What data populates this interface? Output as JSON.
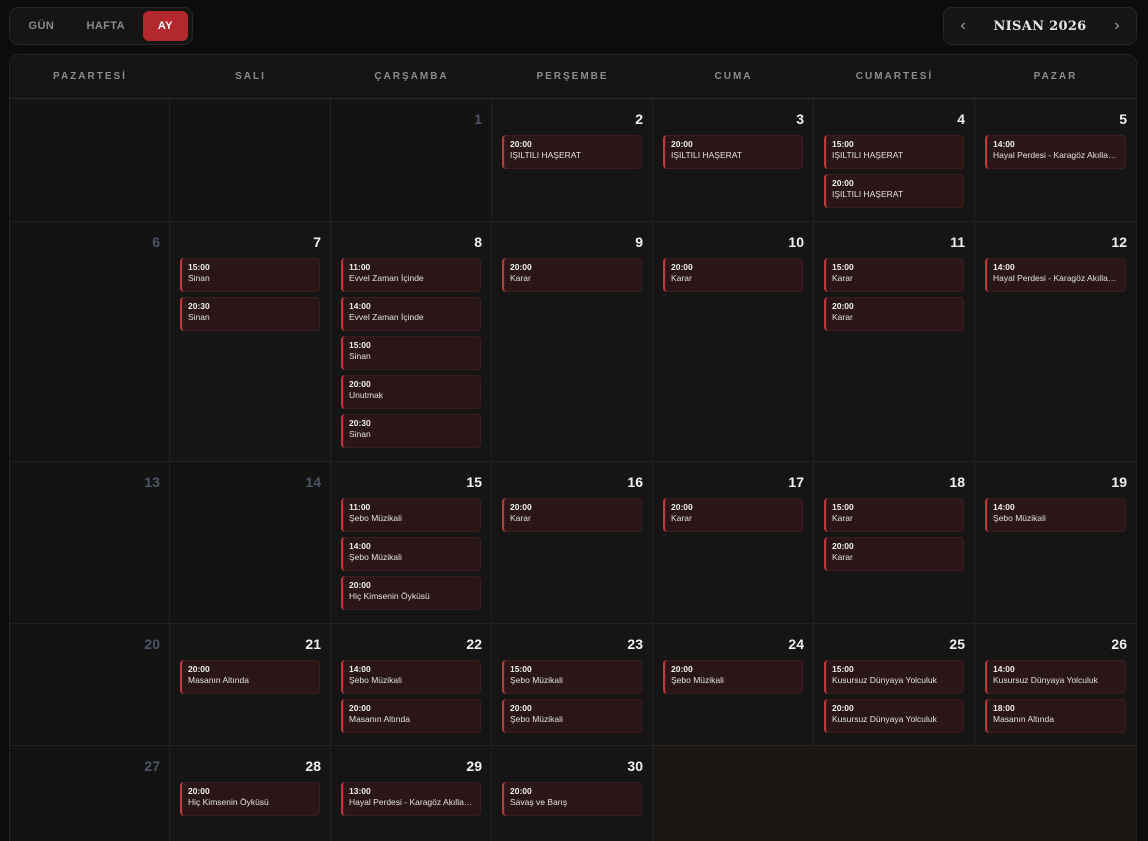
{
  "view_switch": {
    "gun": "GÜN",
    "hafta": "HAFTA",
    "ay": "AY",
    "active": "AY"
  },
  "month_nav": {
    "prev": "‹",
    "title": "NISAN 2026",
    "next": "›"
  },
  "colors": {
    "accent": "#b3282c",
    "event_bg": "#2a1616",
    "event_border": "#c0393c"
  },
  "weekdays": [
    "PAZARTESİ",
    "SALI",
    "ÇARŞAMBA",
    "PERŞEMBE",
    "CUMA",
    "CUMARTESİ",
    "PAZAR"
  ],
  "weeks": [
    [
      {
        "day": "",
        "muted": true,
        "events": []
      },
      {
        "day": "",
        "muted": true,
        "events": []
      },
      {
        "day": "1",
        "muted": true,
        "events": []
      },
      {
        "day": "2",
        "muted": false,
        "events": [
          {
            "time": "20:00",
            "title": "IŞILTILI HAŞERAT"
          }
        ]
      },
      {
        "day": "3",
        "muted": false,
        "events": [
          {
            "time": "20:00",
            "title": "IŞILTILI HAŞERAT"
          }
        ]
      },
      {
        "day": "4",
        "muted": false,
        "events": [
          {
            "time": "15:00",
            "title": "IŞILTILI HAŞERAT"
          },
          {
            "time": "20:00",
            "title": "IŞILTILI HAŞERAT"
          }
        ]
      },
      {
        "day": "5",
        "muted": false,
        "events": [
          {
            "time": "14:00",
            "title": "Hayal Perdesi - Karagöz Akıllanıy..."
          }
        ]
      }
    ],
    [
      {
        "day": "6",
        "muted": true,
        "events": []
      },
      {
        "day": "7",
        "muted": false,
        "events": [
          {
            "time": "15:00",
            "title": "Sinan"
          },
          {
            "time": "20:30",
            "title": "Sinan"
          }
        ]
      },
      {
        "day": "8",
        "muted": false,
        "events": [
          {
            "time": "11:00",
            "title": "Evvel Zaman İçinde"
          },
          {
            "time": "14:00",
            "title": "Evvel Zaman İçinde"
          },
          {
            "time": "15:00",
            "title": "Sinan"
          },
          {
            "time": "20:00",
            "title": "Unutmak"
          },
          {
            "time": "20:30",
            "title": "Sinan"
          }
        ]
      },
      {
        "day": "9",
        "muted": false,
        "events": [
          {
            "time": "20:00",
            "title": "Karar"
          }
        ]
      },
      {
        "day": "10",
        "muted": false,
        "events": [
          {
            "time": "20:00",
            "title": "Karar"
          }
        ]
      },
      {
        "day": "11",
        "muted": false,
        "events": [
          {
            "time": "15:00",
            "title": "Karar"
          },
          {
            "time": "20:00",
            "title": "Karar"
          }
        ]
      },
      {
        "day": "12",
        "muted": false,
        "events": [
          {
            "time": "14:00",
            "title": "Hayal Perdesi - Karagöz Akıllanıy..."
          }
        ]
      }
    ],
    [
      {
        "day": "13",
        "muted": true,
        "events": []
      },
      {
        "day": "14",
        "muted": true,
        "events": []
      },
      {
        "day": "15",
        "muted": false,
        "events": [
          {
            "time": "11:00",
            "title": "Şebo Müzikali"
          },
          {
            "time": "14:00",
            "title": "Şebo Müzikali"
          },
          {
            "time": "20:00",
            "title": "Hiç Kimsenin Öyküsü"
          }
        ]
      },
      {
        "day": "16",
        "muted": false,
        "events": [
          {
            "time": "20:00",
            "title": "Karar"
          }
        ]
      },
      {
        "day": "17",
        "muted": false,
        "events": [
          {
            "time": "20:00",
            "title": "Karar"
          }
        ]
      },
      {
        "day": "18",
        "muted": false,
        "events": [
          {
            "time": "15:00",
            "title": "Karar"
          },
          {
            "time": "20:00",
            "title": "Karar"
          }
        ]
      },
      {
        "day": "19",
        "muted": false,
        "events": [
          {
            "time": "14:00",
            "title": "Şebo Müzikali"
          }
        ]
      }
    ],
    [
      {
        "day": "20",
        "muted": true,
        "events": []
      },
      {
        "day": "21",
        "muted": false,
        "events": [
          {
            "time": "20:00",
            "title": "Masanın Altında"
          }
        ]
      },
      {
        "day": "22",
        "muted": false,
        "events": [
          {
            "time": "14:00",
            "title": "Şebo Müzikali"
          },
          {
            "time": "20:00",
            "title": "Masanın Altında"
          }
        ]
      },
      {
        "day": "23",
        "muted": false,
        "events": [
          {
            "time": "15:00",
            "title": "Şebo Müzikali"
          },
          {
            "time": "20:00",
            "title": "Şebo Müzikali"
          }
        ]
      },
      {
        "day": "24",
        "muted": false,
        "events": [
          {
            "time": "20:00",
            "title": "Şebo Müzikali"
          }
        ]
      },
      {
        "day": "25",
        "muted": false,
        "events": [
          {
            "time": "15:00",
            "title": "Kusursuz Dünyaya Yolculuk"
          },
          {
            "time": "20:00",
            "title": "Kusursuz Dünyaya Yolculuk"
          }
        ]
      },
      {
        "day": "26",
        "muted": false,
        "events": [
          {
            "time": "14:00",
            "title": "Kusursuz Dünyaya Yolculuk"
          },
          {
            "time": "18:00",
            "title": "Masanın Altında"
          }
        ]
      }
    ],
    [
      {
        "day": "27",
        "muted": true,
        "events": []
      },
      {
        "day": "28",
        "muted": false,
        "events": [
          {
            "time": "20:00",
            "title": "Hiç Kimsenin Öyküsü"
          }
        ]
      },
      {
        "day": "29",
        "muted": false,
        "events": [
          {
            "time": "13:00",
            "title": "Hayal Perdesi - Karagöz Akıllanıy..."
          }
        ]
      },
      {
        "day": "30",
        "muted": false,
        "events": [
          {
            "time": "20:00",
            "title": "Savaş ve Barış"
          }
        ]
      },
      {
        "day": "",
        "muted": false,
        "empty": true,
        "events": []
      },
      {
        "day": "",
        "muted": false,
        "empty": true,
        "events": []
      },
      {
        "day": "",
        "muted": false,
        "empty": true,
        "events": []
      }
    ]
  ]
}
